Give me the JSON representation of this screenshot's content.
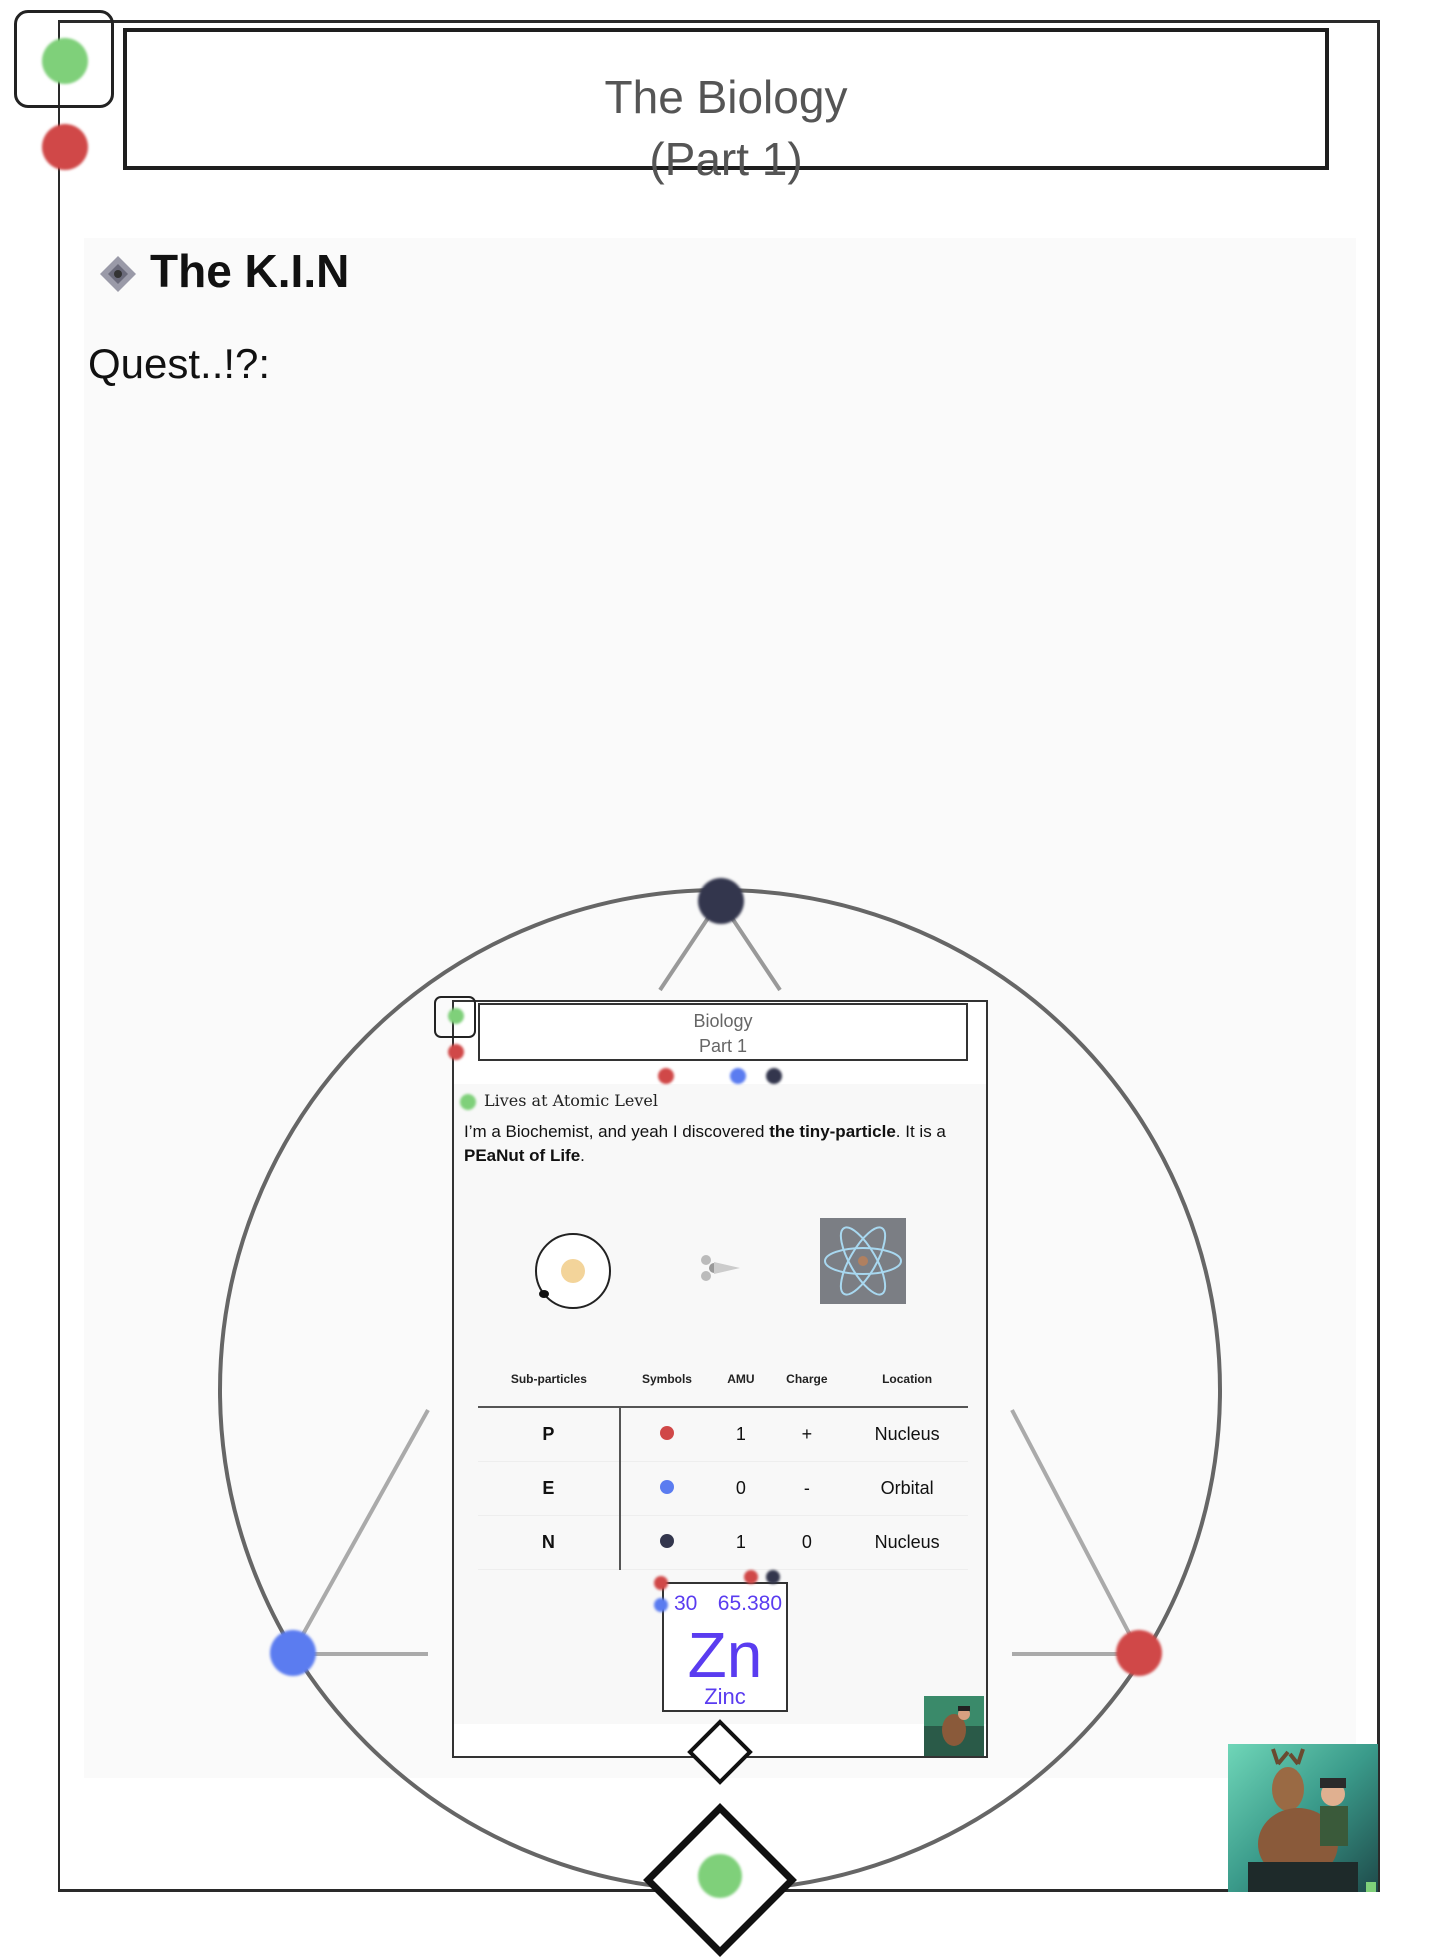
{
  "page": {
    "title_line1": "The Biology",
    "title_line2": "(Part 1)",
    "heading": "The K.I.N",
    "subheading": "Quest..!?:"
  },
  "card": {
    "title_line1": "Biology",
    "title_line2": "Part 1",
    "section_heading": "Lives at Atomic Level",
    "intro_text_1": "I’m a Biochemist, and yeah I discovered ",
    "intro_bold_1": "the tiny-particle",
    "intro_text_2": ". It is a ",
    "intro_bold_2": "PEaNut of Life",
    "intro_text_3": "."
  },
  "table": {
    "headers": [
      "Sub-particles",
      "Symbols",
      "AMU",
      "Charge",
      "Location"
    ],
    "rows": [
      {
        "particle": "P",
        "symbol_color": "#d04848",
        "amu": "1",
        "charge": "+",
        "location": "Nucleus"
      },
      {
        "particle": "E",
        "symbol_color": "#5b7cf0",
        "amu": "0",
        "charge": "-",
        "location": "Orbital"
      },
      {
        "particle": "N",
        "symbol_color": "#33364d",
        "amu": "1",
        "charge": "0",
        "location": "Nucleus"
      }
    ]
  },
  "element": {
    "atomic_number": "30",
    "atomic_mass": "65.380",
    "symbol": "Zn",
    "name": "Zinc",
    "color": "#5a3cf0"
  },
  "colors": {
    "proton": "#d04848",
    "electron": "#5b7cf0",
    "neutron": "#33364d",
    "green": "#7fd07a"
  },
  "icons": [
    "diamond-bullet-icon",
    "atom-orbit-icon",
    "arrow-icon",
    "atom-image-icon",
    "deer-rider-avatar"
  ]
}
